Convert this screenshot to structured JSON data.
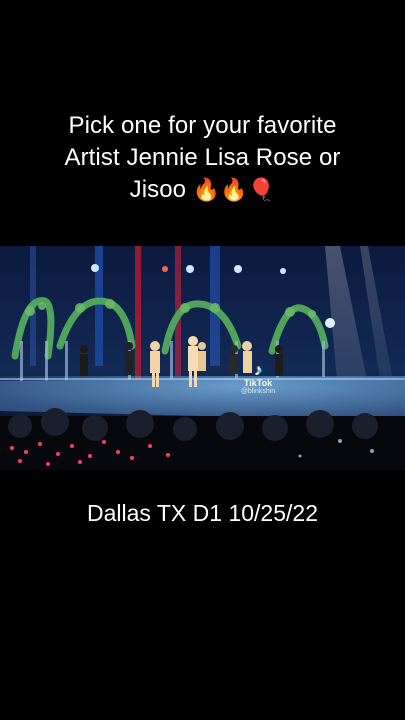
{
  "overlay_text": {
    "line1": "Pick one for your favorite",
    "line2": "Artist Jennie Lisa Rose or",
    "line3": "Jisoo",
    "emojis": "🔥🔥🎈"
  },
  "video": {
    "watermark_app": "TikTok",
    "watermark_handle": "@blinkshin"
  },
  "bottom_caption": "Dallas TX D1 10/25/22"
}
